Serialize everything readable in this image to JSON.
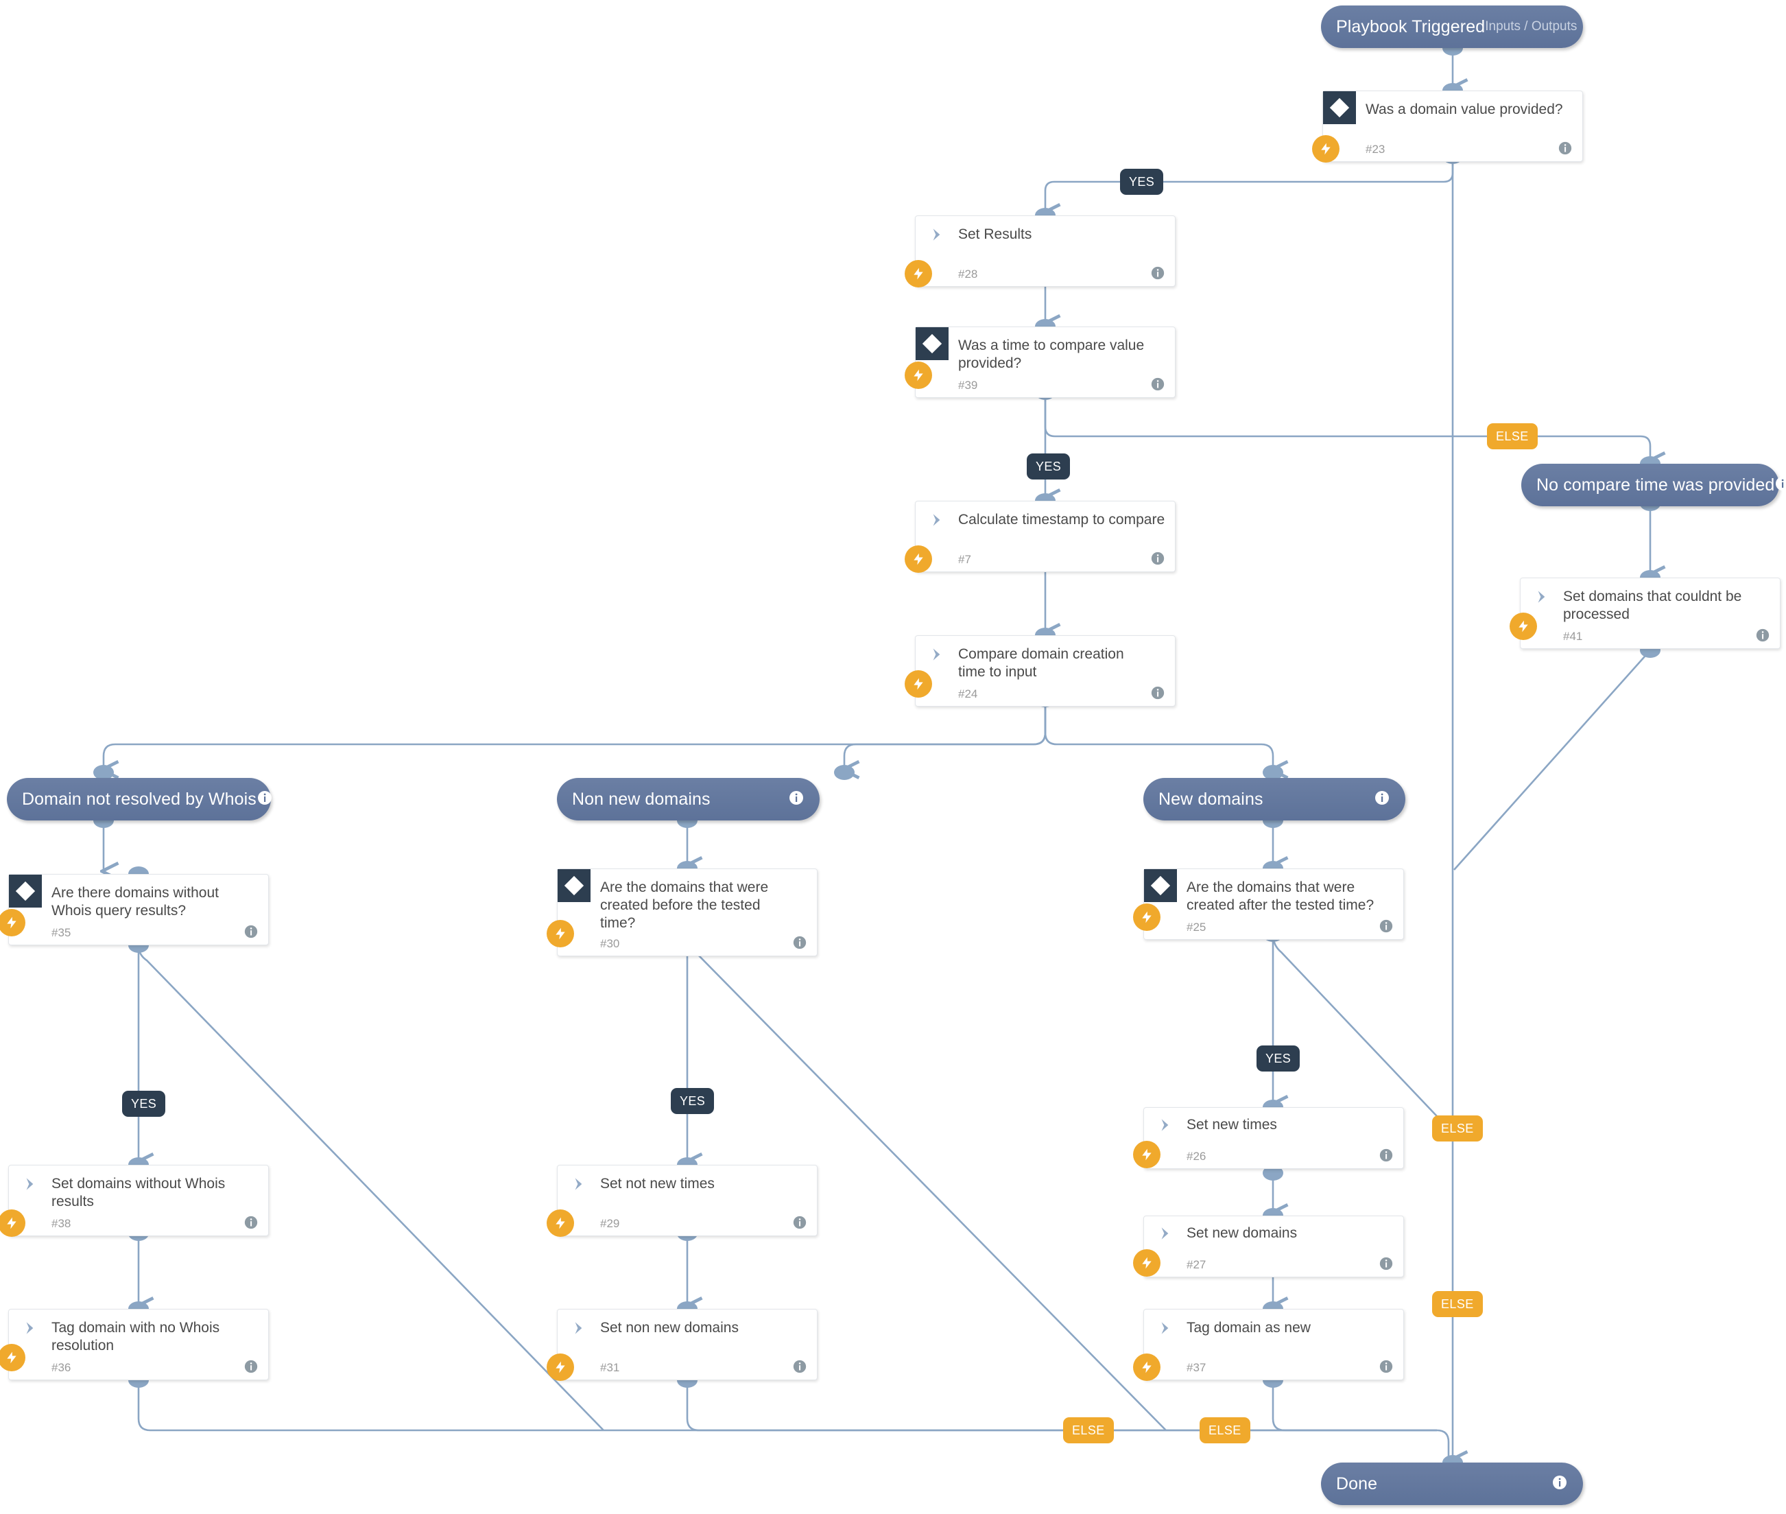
{
  "diagram": {
    "type": "playbook-workflow",
    "colors": {
      "pill": "#647a9f",
      "card_border": "#e3e6ea",
      "condition_square": "#2d3e50",
      "bolt_badge": "#f0a92c",
      "yes_badge": "#2d3e50",
      "else_badge": "#f0a92c",
      "edge": "#8ba6c4",
      "card_title_text": "#4a4a4a",
      "card_id_text": "#9a9a9a"
    },
    "start": {
      "title": "Playbook Triggered",
      "subtitle": "Inputs / Outputs"
    },
    "end": {
      "title": "Done"
    },
    "sections": [
      {
        "title": "Domain not resolved by Whois"
      },
      {
        "title": "Non new domains"
      },
      {
        "title": "New domains"
      },
      {
        "title": "No compare time was provided"
      }
    ],
    "nodes": [
      {
        "title": "Was a domain value provided?",
        "id": "#23",
        "kind": "condition"
      },
      {
        "title": "Set Results",
        "id": "#28",
        "kind": "task"
      },
      {
        "title": "Was a time to compare value provided?",
        "id": "#39",
        "kind": "condition"
      },
      {
        "title": "Calculate timestamp to compare",
        "id": "#7",
        "kind": "task"
      },
      {
        "title": "Compare domain creation time to input",
        "id": "#24",
        "kind": "task"
      },
      {
        "title": "Set domains that couldnt be processed",
        "id": "#41",
        "kind": "task"
      },
      {
        "title": "Are there domains without Whois query results?",
        "id": "#35",
        "kind": "condition"
      },
      {
        "title": "Set domains without Whois results",
        "id": "#38",
        "kind": "task"
      },
      {
        "title": "Tag domain with no Whois resolution",
        "id": "#36",
        "kind": "task"
      },
      {
        "title": "Are the domains that were created before the tested time?",
        "id": "#30",
        "kind": "condition"
      },
      {
        "title": "Set not new times",
        "id": "#29",
        "kind": "task"
      },
      {
        "title": "Set non new domains",
        "id": "#31",
        "kind": "task"
      },
      {
        "title": "Are the domains that were created after the tested time?",
        "id": "#25",
        "kind": "condition"
      },
      {
        "title": "Set new times",
        "id": "#26",
        "kind": "task"
      },
      {
        "title": "Set new domains",
        "id": "#27",
        "kind": "task"
      },
      {
        "title": "Tag domain as new",
        "id": "#37",
        "kind": "task"
      }
    ],
    "badges": {
      "yes": "YES",
      "else": "ELSE"
    }
  }
}
